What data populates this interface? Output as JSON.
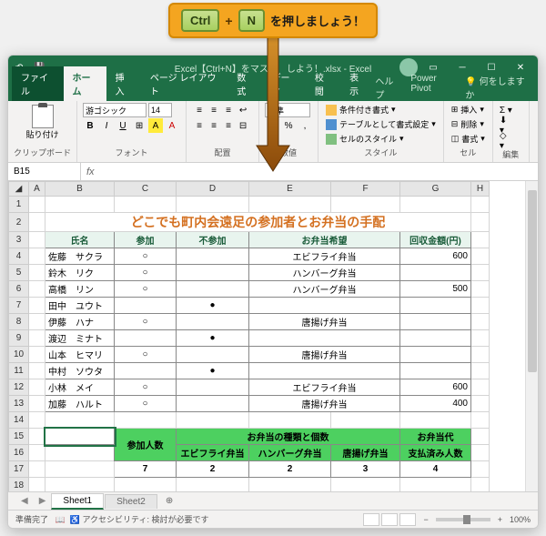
{
  "instruction": {
    "key1": "Ctrl",
    "plus": "+",
    "key2": "N",
    "text": "を押しましょう！"
  },
  "window": {
    "title": "Excel【Ctrl+N】をマス　　しよう！.xlsx  -  Excel"
  },
  "tabs": {
    "file": "ファイル",
    "home": "ホーム",
    "insert": "挿入",
    "layout": "ページ レイアウト",
    "formulas": "数式",
    "data": "データ",
    "review": "校閲",
    "view": "表示",
    "help": "ヘルプ",
    "power": "Power Pivot",
    "tell": "何をしますか"
  },
  "ribbon": {
    "paste": "貼り付け",
    "clipboard": "クリップボード",
    "font_name": "游ゴシック",
    "font_size": "14",
    "font_group": "フォント",
    "align_group": "配置",
    "num_format": "標準",
    "num_group": "数値",
    "cond_format": "条件付き書式",
    "table_format": "テーブルとして書式設定",
    "cell_styles": "セルのスタイル",
    "styles_group": "スタイル",
    "insert_btn": "挿入",
    "delete_btn": "削除",
    "format_btn": "書式",
    "cells_group": "セル",
    "edit_group": "編集"
  },
  "namebox": "B15",
  "fx": "fx",
  "columns": [
    "A",
    "B",
    "C",
    "D",
    "E",
    "F",
    "G",
    "H"
  ],
  "sheet_title": "どこでも町内会遠足の参加者とお弁当の手配",
  "headers": {
    "name": "氏名",
    "attend": "参加",
    "absent": "不参加",
    "bento": "お弁当希望",
    "amount": "回収金額(円)"
  },
  "rows": [
    {
      "name": "佐藤　サクラ",
      "attend": "○",
      "absent": "",
      "bento": "エビフライ弁当",
      "amount": "600"
    },
    {
      "name": "鈴木　リク",
      "attend": "○",
      "absent": "",
      "bento": "ハンバーグ弁当",
      "amount": ""
    },
    {
      "name": "高橋　リン",
      "attend": "○",
      "absent": "",
      "bento": "ハンバーグ弁当",
      "amount": "500"
    },
    {
      "name": "田中　ユウト",
      "attend": "",
      "absent": "●",
      "bento": "",
      "amount": ""
    },
    {
      "name": "伊藤　ハナ",
      "attend": "○",
      "absent": "",
      "bento": "唐揚げ弁当",
      "amount": ""
    },
    {
      "name": "渡辺　ミナト",
      "attend": "",
      "absent": "●",
      "bento": "",
      "amount": ""
    },
    {
      "name": "山本　ヒマリ",
      "attend": "○",
      "absent": "",
      "bento": "唐揚げ弁当",
      "amount": ""
    },
    {
      "name": "中村　ソウタ",
      "attend": "",
      "absent": "●",
      "bento": "",
      "amount": ""
    },
    {
      "name": "小林　メイ",
      "attend": "○",
      "absent": "",
      "bento": "エビフライ弁当",
      "amount": "600"
    },
    {
      "name": "加藤　ハルト",
      "attend": "○",
      "absent": "",
      "bento": "唐揚げ弁当",
      "amount": "400"
    }
  ],
  "summary": {
    "participants_label": "参加人数",
    "bento_types_label": "お弁当の種類と個数",
    "bento_cost_label": "お弁当代",
    "ebi": "エビフライ弁当",
    "hamburg": "ハンバーグ弁当",
    "karaage": "唐揚げ弁当",
    "paid_label": "支払済み人数",
    "participants": "7",
    "ebi_count": "2",
    "hamburg_count": "2",
    "karaage_count": "3",
    "paid_count": "4"
  },
  "sheets": {
    "s1": "Sheet1",
    "s2": "Sheet2",
    "add": "⊕"
  },
  "status": {
    "ready": "準備完了",
    "access": "アクセシビリティ: 検討が必要です",
    "zoom": "100%"
  }
}
